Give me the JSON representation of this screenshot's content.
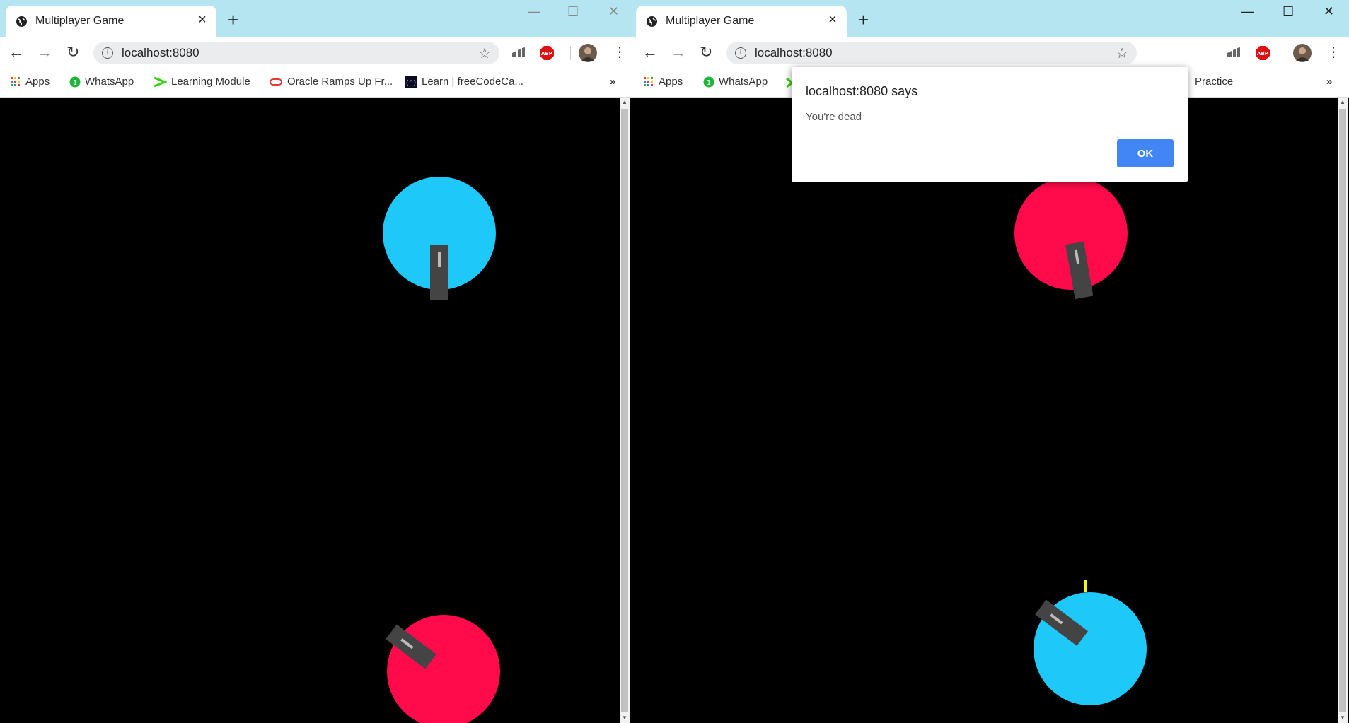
{
  "colors": {
    "titlebar": "#b5e5f0",
    "player_blue": "#1ec8f8",
    "player_red": "#ff0a4a",
    "turret": "#444444",
    "bullet": "#f5f516",
    "dialog_ok": "#4285f4"
  },
  "left_window": {
    "tab_title": "Multiplayer Game",
    "url": "localhost:8080",
    "bookmarks": [
      {
        "label": "Apps",
        "icon": "apps-grid-icon"
      },
      {
        "label": "WhatsApp",
        "icon": "whatsapp-icon"
      },
      {
        "label": "Learning Module",
        "icon": "arrow-icon"
      },
      {
        "label": "Oracle Ramps Up Fr...",
        "icon": "oracle-icon"
      },
      {
        "label": "Learn | freeCodeCa...",
        "icon": "freecodecamp-icon"
      }
    ],
    "overflow": "»"
  },
  "right_window": {
    "tab_title": "Multiplayer Game",
    "url": "localhost:8080",
    "bookmarks": [
      {
        "label": "Apps",
        "icon": "apps-grid-icon"
      },
      {
        "label": "WhatsApp",
        "icon": "whatsapp-icon"
      },
      {
        "label": "Practice",
        "icon": ""
      }
    ],
    "overflow": "»"
  },
  "dialog": {
    "title": "localhost:8080 says",
    "message": "You're dead",
    "ok_label": "OK"
  }
}
